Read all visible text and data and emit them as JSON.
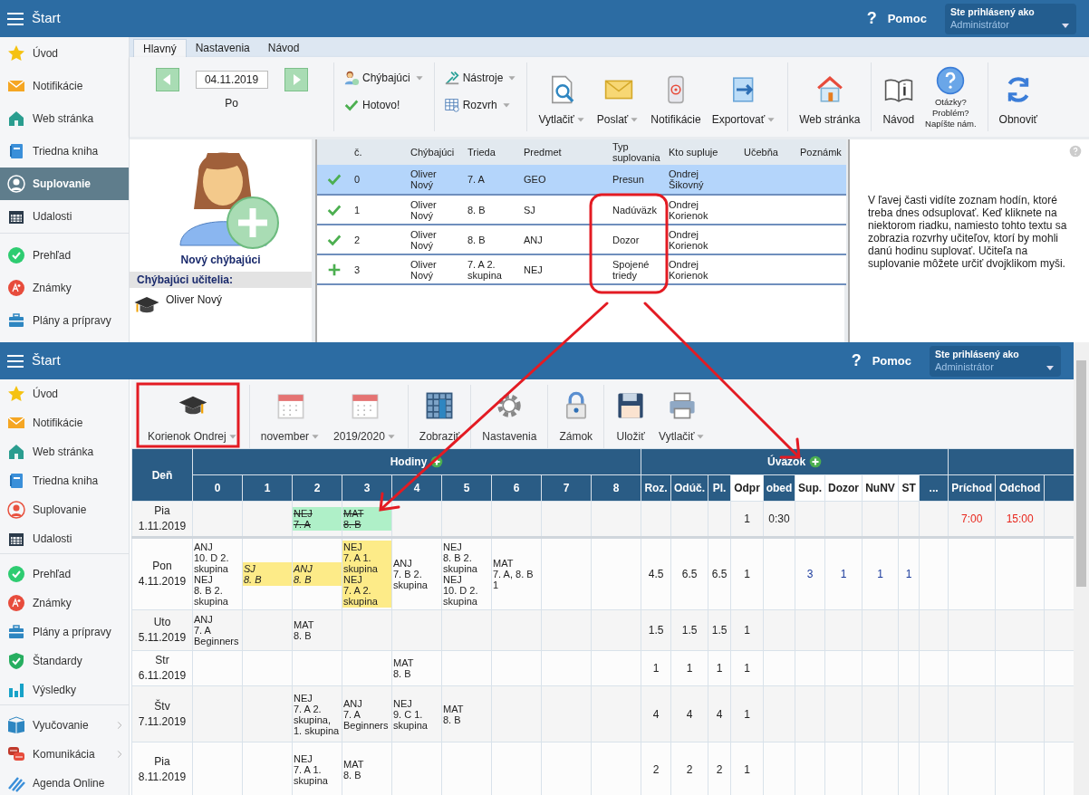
{
  "top_window": {
    "header": {
      "help_mark": "?",
      "title": "Štart",
      "help": "Pomoc",
      "user_label": "Ste prihlásený ako",
      "user": "Administrátor"
    },
    "sidebar": {
      "groups": [
        [
          {
            "label": "Úvod",
            "selected": false
          },
          {
            "label": "Notifikácie",
            "selected": false
          },
          {
            "label": "Web stránka",
            "selected": false
          },
          {
            "label": "Triedna kniha",
            "selected": false
          },
          {
            "label": "Suplovanie",
            "selected": true
          },
          {
            "label": "Udalosti",
            "selected": false
          }
        ],
        [
          {
            "label": "Prehľad",
            "selected": false
          },
          {
            "label": "Známky",
            "selected": false
          },
          {
            "label": "Plány a prípravy",
            "selected": false
          }
        ]
      ]
    },
    "tabs": [
      {
        "label": "Hlavný",
        "selected": true
      },
      {
        "label": "Nastavenia",
        "selected": false
      },
      {
        "label": "Návod",
        "selected": false
      }
    ],
    "date_nav": {
      "date": "04.11.2019",
      "day": "Po"
    },
    "toolbar": [
      [
        {
          "kind": "small",
          "label": "Chýbajúci",
          "dropdown": true
        },
        {
          "kind": "small",
          "label": "Hotovo!",
          "dropdown": false
        }
      ],
      [
        {
          "kind": "small",
          "label": "Nástroje",
          "dropdown": true
        },
        {
          "kind": "small",
          "label": "Rozvrh",
          "dropdown": true
        }
      ],
      [
        {
          "kind": "large",
          "label": "Vytlačiť",
          "dropdown": true
        },
        {
          "kind": "large",
          "label": "Poslať",
          "dropdown": true
        },
        {
          "kind": "large",
          "label": "Notifikácie",
          "dropdown": false
        },
        {
          "kind": "large",
          "label": "Exportovať",
          "dropdown": true
        }
      ],
      [
        {
          "kind": "large",
          "label": "Web stránka",
          "dropdown": false
        }
      ],
      [
        {
          "kind": "large",
          "label": "Návod",
          "dropdown": false
        },
        {
          "kind": "note",
          "label": "Otázky?\nProblém?\nNapíšte nám.",
          "dropdown": false
        }
      ],
      [
        {
          "kind": "large",
          "label": "Obnoviť",
          "dropdown": false
        }
      ]
    ],
    "new_absent": "Nový chýbajúci",
    "absent_teachers": {
      "title": "Chýbajúci učitelia:",
      "items": [
        "Oliver Nový"
      ]
    },
    "table": {
      "columns": [
        "č.",
        "Chýbajúci",
        "Trieda",
        "Predmet",
        "Typ suplovania",
        "Kto supluje",
        "Učebňa",
        "Poznámk"
      ],
      "rows": [
        {
          "kind": "done",
          "selected": true,
          "cells": [
            "0",
            "Oliver Nový",
            "7. A",
            "GEO",
            "Presun",
            "Ondrej Šikovný"
          ]
        },
        {
          "kind": "done",
          "selected": false,
          "cells": [
            "1",
            "Oliver Nový",
            "8. B",
            "SJ",
            "Nadúväzk",
            "Ondrej Korienok"
          ]
        },
        {
          "kind": "done",
          "selected": false,
          "cells": [
            "2",
            "Oliver Nový",
            "8. B",
            "ANJ",
            "Dozor",
            "Ondrej Korienok"
          ]
        },
        {
          "kind": "added",
          "selected": false,
          "cells": [
            "3",
            "Oliver Nový",
            "7. A 2. skupina",
            "NEJ",
            "Spojené triedy",
            "Ondrej Korienok"
          ]
        }
      ]
    },
    "help_text": "V ľavej časti vidíte zoznam hodín, ktoré treba dnes odsuplovať. Keď kliknete na niektorom riadku, namiesto tohto textu sa zobrazia rozvrhy učiteľov, ktorí by mohli danú hodinu suplovať. Učiteľa na suplovanie môžete určiť dvojklikom myši."
  },
  "bottom_window": {
    "header": {
      "help_mark": "?",
      "title": "Štart",
      "help": "Pomoc",
      "user_label": "Ste prihlásený ako",
      "user": "Administrátor"
    },
    "sidebar": {
      "groups": [
        [
          {
            "label": "Úvod",
            "submenu": false
          },
          {
            "label": "Notifikácie",
            "submenu": false
          },
          {
            "label": "Web stránka",
            "submenu": false
          },
          {
            "label": "Triedna kniha",
            "submenu": false
          },
          {
            "label": "Suplovanie",
            "submenu": false
          },
          {
            "label": "Udalosti",
            "submenu": false
          }
        ],
        [
          {
            "label": "Prehľad",
            "submenu": false
          },
          {
            "label": "Známky",
            "submenu": false
          },
          {
            "label": "Plány a prípravy",
            "submenu": false
          },
          {
            "label": "Štandardy",
            "submenu": false
          },
          {
            "label": "Výsledky",
            "submenu": false
          }
        ],
        [
          {
            "label": "Vyučovanie",
            "submenu": true
          },
          {
            "label": "Komunikácia",
            "submenu": true
          },
          {
            "label": "Agenda Online",
            "submenu": false
          }
        ]
      ]
    },
    "toolbar": [
      [
        {
          "label": "Korienok Ondrej",
          "dropdown": true
        }
      ],
      [
        {
          "label": "november",
          "dropdown": true
        },
        {
          "label": "2019/2020",
          "dropdown": true
        }
      ],
      [
        {
          "label": "Zobraziť",
          "dropdown": false
        }
      ],
      [
        {
          "label": "Nastavenia",
          "dropdown": false
        }
      ],
      [
        {
          "label": "Zámok",
          "dropdown": false
        }
      ],
      [
        {
          "label": "Uložiť",
          "dropdown": false
        },
        {
          "label": "Vytlačiť",
          "dropdown": true
        }
      ]
    ],
    "table": {
      "day_header": "Deň",
      "groups": [
        {
          "label": "Hodiny",
          "add": true
        },
        {
          "label": "Úväzok",
          "add": true
        }
      ],
      "period_columns": [
        "0",
        "1",
        "2",
        "3",
        "4",
        "5",
        "6",
        "7",
        "8"
      ],
      "stat_columns": [
        {
          "label": "Roz.",
          "kind": "plain"
        },
        {
          "label": "Odúč.",
          "kind": "plain"
        },
        {
          "label": "Pl.",
          "kind": "plain"
        },
        {
          "label": "Odpr",
          "kind": "absence"
        },
        {
          "label": "obed",
          "kind": "plain"
        },
        {
          "label": "Sup.",
          "kind": "duty"
        },
        {
          "label": "Dozor",
          "kind": "duty"
        },
        {
          "label": "NuNV",
          "kind": "duty"
        },
        {
          "label": "ST",
          "kind": "duty"
        },
        {
          "label": "...",
          "kind": "plain"
        }
      ],
      "time_columns": [
        "Príchod",
        "Odchod"
      ],
      "rows": [
        {
          "day": "Pia",
          "date": "1.11.2019",
          "lessons": [
            {
              "kind": "empty"
            },
            {
              "kind": "empty"
            },
            {
              "kind": "cancelled",
              "lines": [
                "NEJ",
                "7. A"
              ]
            },
            {
              "kind": "cancelled",
              "lines": [
                "MAT",
                "8. B"
              ]
            },
            {
              "kind": "empty"
            },
            {
              "kind": "empty"
            },
            {
              "kind": "empty"
            },
            {
              "kind": "empty"
            },
            {
              "kind": "empty"
            }
          ],
          "stats": [
            {
              "kind": "empty"
            },
            {
              "kind": "empty"
            },
            {
              "kind": "empty"
            },
            {
              "kind": "value",
              "text": "1"
            },
            {
              "kind": "value",
              "text": "0:30"
            },
            {
              "kind": "empty"
            },
            {
              "kind": "empty"
            },
            {
              "kind": "empty"
            },
            {
              "kind": "empty"
            },
            {
              "kind": "empty"
            }
          ],
          "times": [
            {
              "kind": "late",
              "text": "7:00"
            },
            {
              "kind": "late",
              "text": "15:00"
            }
          ]
        },
        {
          "day": "Pon",
          "date": "4.11.2019",
          "lessons": [
            {
              "kind": "normal",
              "lines": [
                "ANJ",
                "10. D 2. skupina",
                "NEJ",
                "8. B 2. skupina"
              ]
            },
            {
              "kind": "covered",
              "lines": [
                "SJ",
                "8. B"
              ]
            },
            {
              "kind": "covered",
              "lines": [
                "ANJ",
                "8. B"
              ]
            },
            {
              "kind": "extra",
              "lines": [
                "NEJ",
                "7. A 1. skupina",
                "NEJ",
                "7. A 2. skupina"
              ]
            },
            {
              "kind": "normal",
              "lines": [
                "ANJ",
                "7. B 2. skupina"
              ]
            },
            {
              "kind": "normal",
              "lines": [
                "NEJ",
                "8. B 2. skupina",
                "NEJ",
                "10. D 2. skupina"
              ]
            },
            {
              "kind": "normal",
              "lines": [
                "MAT",
                "7. A, 8. B",
                "1"
              ]
            },
            {
              "kind": "empty"
            },
            {
              "kind": "empty"
            }
          ],
          "stats": [
            {
              "kind": "value",
              "text": "4.5"
            },
            {
              "kind": "value",
              "text": "6.5"
            },
            {
              "kind": "value",
              "text": "6.5"
            },
            {
              "kind": "value",
              "text": "1"
            },
            {
              "kind": "empty"
            },
            {
              "kind": "value",
              "text": "3"
            },
            {
              "kind": "value",
              "text": "1"
            },
            {
              "kind": "value",
              "text": "1"
            },
            {
              "kind": "value",
              "text": "1"
            },
            {
              "kind": "empty"
            }
          ],
          "times": [
            {
              "kind": "empty"
            },
            {
              "kind": "empty"
            }
          ]
        },
        {
          "day": "Uto",
          "date": "5.11.2019",
          "lessons": [
            {
              "kind": "normal",
              "lines": [
                "ANJ",
                "7. A",
                "Beginners"
              ]
            },
            {
              "kind": "empty"
            },
            {
              "kind": "normal",
              "lines": [
                "MAT",
                "8. B"
              ]
            },
            {
              "kind": "empty"
            },
            {
              "kind": "empty"
            },
            {
              "kind": "empty"
            },
            {
              "kind": "empty"
            },
            {
              "kind": "empty"
            },
            {
              "kind": "empty"
            }
          ],
          "stats": [
            {
              "kind": "value",
              "text": "1.5"
            },
            {
              "kind": "value",
              "text": "1.5"
            },
            {
              "kind": "value",
              "text": "1.5"
            },
            {
              "kind": "value",
              "text": "1"
            },
            {
              "kind": "empty"
            },
            {
              "kind": "empty"
            },
            {
              "kind": "empty"
            },
            {
              "kind": "empty"
            },
            {
              "kind": "empty"
            },
            {
              "kind": "empty"
            }
          ],
          "times": [
            {
              "kind": "empty"
            },
            {
              "kind": "empty"
            }
          ]
        },
        {
          "day": "Str",
          "date": "6.11.2019",
          "lessons": [
            {
              "kind": "empty"
            },
            {
              "kind": "empty"
            },
            {
              "kind": "empty"
            },
            {
              "kind": "empty"
            },
            {
              "kind": "normal",
              "lines": [
                "MAT",
                "8. B"
              ]
            },
            {
              "kind": "empty"
            },
            {
              "kind": "empty"
            },
            {
              "kind": "empty"
            },
            {
              "kind": "empty"
            }
          ],
          "stats": [
            {
              "kind": "value",
              "text": "1"
            },
            {
              "kind": "value",
              "text": "1"
            },
            {
              "kind": "value",
              "text": "1"
            },
            {
              "kind": "value",
              "text": "1"
            },
            {
              "kind": "empty"
            },
            {
              "kind": "empty"
            },
            {
              "kind": "empty"
            },
            {
              "kind": "empty"
            },
            {
              "kind": "empty"
            },
            {
              "kind": "empty"
            }
          ],
          "times": [
            {
              "kind": "empty"
            },
            {
              "kind": "empty"
            }
          ]
        },
        {
          "day": "Štv",
          "date": "7.11.2019",
          "lessons": [
            {
              "kind": "empty"
            },
            {
              "kind": "empty"
            },
            {
              "kind": "normal",
              "lines": [
                "NEJ",
                "7. A 2. skupina, 1. skupina"
              ]
            },
            {
              "kind": "normal",
              "lines": [
                "ANJ",
                "7. A",
                "Beginners"
              ]
            },
            {
              "kind": "normal",
              "lines": [
                "NEJ",
                "9. C 1. skupina"
              ]
            },
            {
              "kind": "normal",
              "lines": [
                "MAT",
                "8. B"
              ]
            },
            {
              "kind": "empty"
            },
            {
              "kind": "empty"
            },
            {
              "kind": "empty"
            }
          ],
          "stats": [
            {
              "kind": "value",
              "text": "4"
            },
            {
              "kind": "value",
              "text": "4"
            },
            {
              "kind": "value",
              "text": "4"
            },
            {
              "kind": "value",
              "text": "1"
            },
            {
              "kind": "empty"
            },
            {
              "kind": "empty"
            },
            {
              "kind": "empty"
            },
            {
              "kind": "empty"
            },
            {
              "kind": "empty"
            },
            {
              "kind": "empty"
            }
          ],
          "times": [
            {
              "kind": "empty"
            },
            {
              "kind": "empty"
            }
          ]
        },
        {
          "day": "Pia",
          "date": "8.11.2019",
          "lessons": [
            {
              "kind": "empty"
            },
            {
              "kind": "empty"
            },
            {
              "kind": "normal",
              "lines": [
                "NEJ",
                "7. A 1. skupina"
              ]
            },
            {
              "kind": "normal",
              "lines": [
                "MAT",
                "8. B"
              ]
            },
            {
              "kind": "empty"
            },
            {
              "kind": "empty"
            },
            {
              "kind": "empty"
            },
            {
              "kind": "empty"
            },
            {
              "kind": "empty"
            }
          ],
          "stats": [
            {
              "kind": "value",
              "text": "2"
            },
            {
              "kind": "value",
              "text": "2"
            },
            {
              "kind": "value",
              "text": "2"
            },
            {
              "kind": "value",
              "text": "1"
            },
            {
              "kind": "empty"
            },
            {
              "kind": "empty"
            },
            {
              "kind": "empty"
            },
            {
              "kind": "empty"
            },
            {
              "kind": "empty"
            },
            {
              "kind": "empty"
            }
          ],
          "times": [
            {
              "kind": "empty"
            },
            {
              "kind": "empty"
            }
          ]
        }
      ]
    }
  }
}
